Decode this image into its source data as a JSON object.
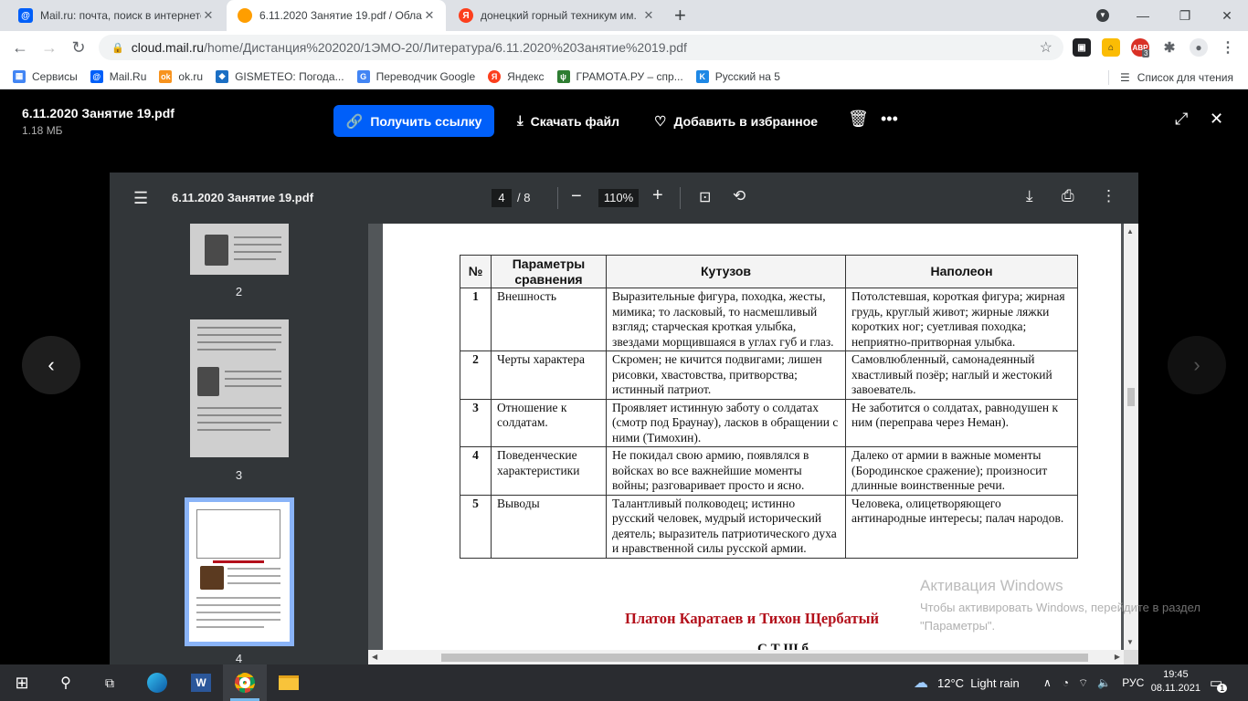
{
  "browser": {
    "tabs": [
      {
        "title": "Mail.ru: почта, поиск в интернете",
        "favicon": "mailru-icon",
        "color": "#005ff9"
      },
      {
        "title": "6.11.2020 Занятие 19.pdf / Облако",
        "favicon": "cloud-icon",
        "color": "#ff9e00"
      },
      {
        "title": "донецкий горный техникум им.",
        "favicon": "yandex-icon",
        "color": "#fc3f1d"
      }
    ],
    "url_host": "cloud.mail.ru",
    "url_path": "/home/Дистанция%202020/1ЭМО-20/Литература/6.11.2020%20Занятие%2019.pdf",
    "ext_badge": "3",
    "ext_abbr": "ABP",
    "bookmarks": [
      {
        "label": "Сервисы",
        "icon": "apps-grid-icon",
        "color": "#4285f4"
      },
      {
        "label": "Mail.Ru",
        "icon": "mailru-icon",
        "color": "#005ff9"
      },
      {
        "label": "ok.ru",
        "icon": "odnoklassniki-icon",
        "color": "#f7931e"
      },
      {
        "label": "GISMETEO: Погода...",
        "icon": "gismeteo-icon",
        "color": "#1b6fc4"
      },
      {
        "label": "Переводчик Google",
        "icon": "google-translate-icon",
        "color": "#4285f4"
      },
      {
        "label": "Яндекс",
        "icon": "yandex-icon",
        "color": "#fc3f1d"
      },
      {
        "label": "ГРАМОТА.РУ – спр...",
        "icon": "gramota-icon",
        "color": "#2e7d32"
      },
      {
        "label": "Русский на 5",
        "icon": "russian5-icon",
        "color": "#1e88e5"
      }
    ],
    "reading_list": "Список для чтения"
  },
  "cloud": {
    "file_name": "6.11.2020 Занятие 19.pdf",
    "file_size": "1.18 МБ",
    "get_link": "Получить ссылку",
    "download": "Скачать файл",
    "favorite": "Добавить в избранное",
    "accent": "#005ff9"
  },
  "pdf": {
    "title": "6.11.2020 Занятие 19.pdf",
    "page_current": "4",
    "page_total": "/  8",
    "zoom": "110%",
    "thumbs": [
      {
        "label": "2"
      },
      {
        "label": "3"
      },
      {
        "label": "4"
      }
    ]
  },
  "table": {
    "headers": [
      "№",
      "Параметры сравнения",
      "Кутузов",
      "Наполеон"
    ],
    "rows": [
      {
        "num": "1",
        "param": "Внешность",
        "kutuzov": "Выразительные фигура, походка, жесты, мимика; то ласковый, то насмешливый взгляд; старческая кроткая улыбка, звездами морщившаяся в углах губ и глаз.",
        "napoleon": "Потолстевшая, короткая фигура; жирная грудь, круглый живот; жирные ляжки коротких ног; суетливая походка; неприятно-притворная улыбка."
      },
      {
        "num": "2",
        "param": "Черты характера",
        "kutuzov": "Скромен; не кичится подвигами; лишен рисовки, хвастовства, притворства; истинный патриот.",
        "napoleon": "Самовлюбленный, самонадеянный хвастливый позёр; наглый и жестокий завоеватель."
      },
      {
        "num": "3",
        "param": "Отношение к солдатам.",
        "kutuzov": "Проявляет истинную заботу о солдатах (смотр под Браунау), ласков в обращении с ними (Тимохин).",
        "napoleon": "Не заботится о солдатах, равнодушен к ним (переправа через Неман)."
      },
      {
        "num": "4",
        "param": "Поведенческие характеристики",
        "kutuzov": "Не покидал свою армию, появлялся в войсках во все важнейшие моменты войны; разговаривает просто и ясно.",
        "napoleon": "Далеко от армии в важные моменты (Бородинское сражение); произносит длинные воинственные речи."
      },
      {
        "num": "5",
        "param": "Выводы",
        "kutuzov": "Талантливый полководец; истинно русский человек, мудрый исторический деятель; выразитель патриотического духа и нравственной силы русской армии.",
        "napoleon": "Человека, олицетворяющего антинародные интересы; палач народов."
      }
    ],
    "subheading": "Платон Каратаев и Тихон Щербатый",
    "partial_line": "С Т          Щ б"
  },
  "windows": {
    "activation_title": "Активация Windows",
    "activation_text": "Чтобы активировать Windows, перейдите в раздел \"Параметры\".",
    "weather": "12°C  Light rain",
    "lang": "РУС",
    "time": "19:45",
    "date": "08.11.2021",
    "notif_count": "1"
  }
}
